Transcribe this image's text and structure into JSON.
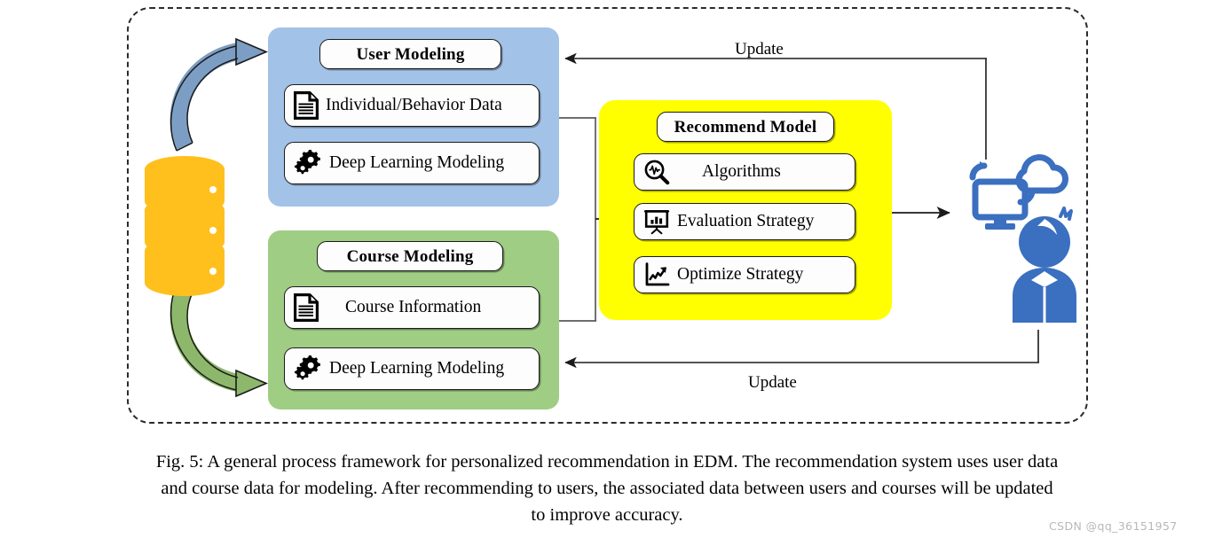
{
  "figure": {
    "frame_label": "personalized-recommendation-framework",
    "colors": {
      "user_panel": "#a3c2e8",
      "course_panel": "#a0cd84",
      "model_panel": "#ffff00",
      "database": "#ffc01e",
      "actor_blue": "#3b6fc0",
      "arrow_blue": "#7d9ec4",
      "arrow_green": "#8db86b",
      "outline": "#1b1b1b"
    }
  },
  "user_panel": {
    "title": "User Modeling",
    "items": [
      {
        "label": "Individual/Behavior Data",
        "icon": "document-icon"
      },
      {
        "label": "Deep Learning  Modeling",
        "icon": "gears-icon"
      }
    ]
  },
  "course_panel": {
    "title": "Course Modeling",
    "items": [
      {
        "label": "Course Information",
        "icon": "document-icon"
      },
      {
        "label": "Deep Learning  Modeling",
        "icon": "gears-icon"
      }
    ]
  },
  "model_panel": {
    "title": "Recommend Model",
    "items": [
      {
        "label": "Algorithms",
        "icon": "magnifier-waveform-icon"
      },
      {
        "label": "Evaluation Strategy",
        "icon": "presentation-chart-icon"
      },
      {
        "label": "Optimize Strategy",
        "icon": "line-chart-up-icon"
      }
    ]
  },
  "connectors": {
    "update_top": "Update",
    "update_bottom": "Update"
  },
  "icons": {
    "database": "database-cylinder-icon",
    "arrow_to_user": "curved-arrow-up-icon",
    "arrow_to_course": "curved-arrow-down-icon",
    "cloud_computer": "cloud-computer-sync-icon",
    "user_person": "person-user-icon"
  },
  "caption": {
    "line1": "Fig. 5: A general process framework for personalized recommendation in EDM. The recommendation system uses user data",
    "line2": "and course data for modeling. After recommending to users, the associated data between users and courses will be updated",
    "line3": "to improve accuracy."
  },
  "watermark": {
    "text": "CSDN @qq_36151957"
  }
}
